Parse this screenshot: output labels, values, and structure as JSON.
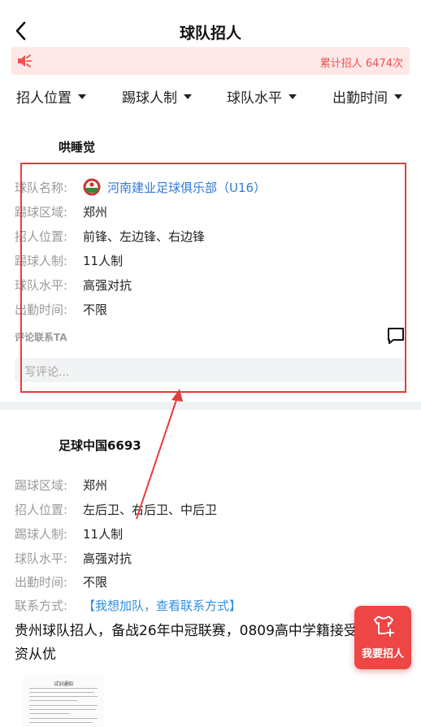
{
  "header": {
    "title": "球队招人"
  },
  "notice": {
    "count_text": "累计招人 6474次"
  },
  "filters": [
    {
      "label": "招人位置"
    },
    {
      "label": "踢球人制"
    },
    {
      "label": "球队水平"
    },
    {
      "label": "出勤时间"
    }
  ],
  "post1": {
    "author": "哄睡觉",
    "fields": [
      {
        "label": "球队名称:",
        "value": "河南建业足球俱乐部（U16）"
      },
      {
        "label": "踢球区域:",
        "value": "郑州"
      },
      {
        "label": "招人位置:",
        "value": "前锋、左边锋、右边锋"
      },
      {
        "label": "踢球人制:",
        "value": "11人制"
      },
      {
        "label": "球队水平:",
        "value": "高强对抗"
      },
      {
        "label": "出勤时间:",
        "value": "不限"
      }
    ],
    "comment_label": "评论联系TA",
    "comment_placeholder": "写评论..."
  },
  "post2": {
    "author": "足球中国6693",
    "fields": [
      {
        "label": "踢球区域:",
        "value": "郑州"
      },
      {
        "label": "招人位置:",
        "value": "左后卫、右后卫、中后卫"
      },
      {
        "label": "踢球人制:",
        "value": "11人制"
      },
      {
        "label": "球队水平:",
        "value": "高强对抗"
      },
      {
        "label": "出勤时间:",
        "value": "不限"
      },
      {
        "label": "联系方式:",
        "value": "【我想加队，查看联系方式】"
      }
    ],
    "description": "贵州球队招人，备战26年中冠联赛，0809高中学籍接受，工资从优",
    "doc_title": "试训通知"
  },
  "fab": {
    "label": "我要招人"
  },
  "colors": {
    "accent_red": "#ee4545",
    "link_blue": "#2f7ad8",
    "notice_bg": "#fde7e7",
    "annotation_red": "#e53c3c"
  }
}
